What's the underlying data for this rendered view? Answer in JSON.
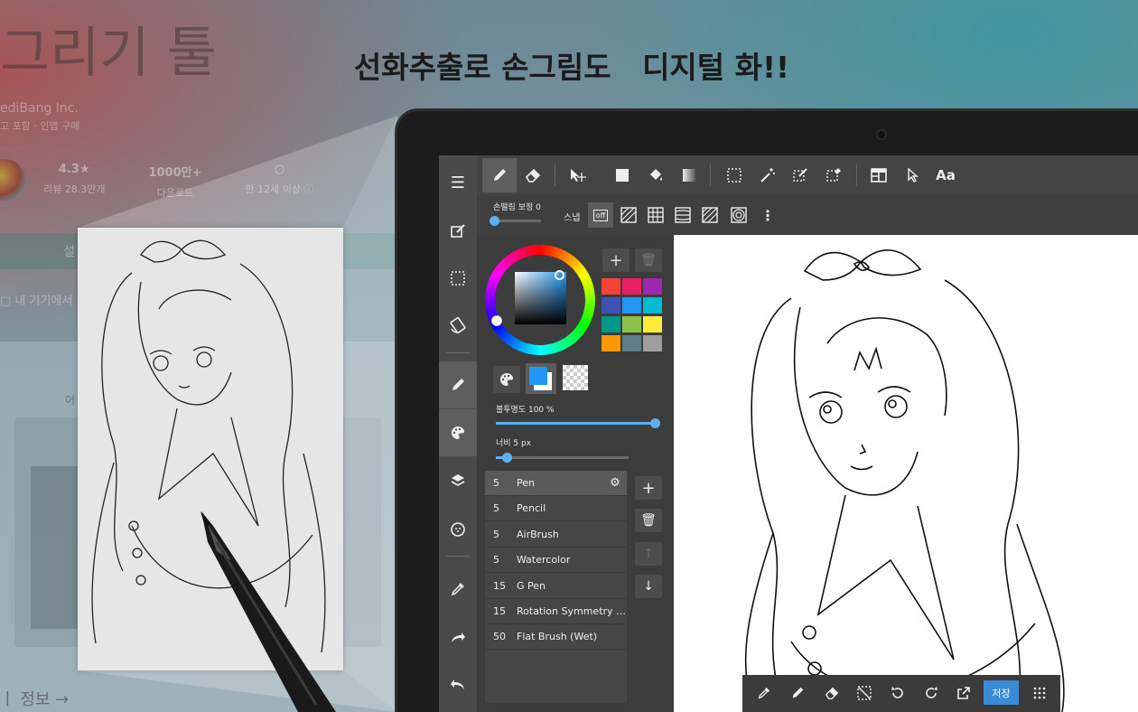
{
  "background": {
    "store_title": "그리기 툴",
    "developer": "ediBang Inc.",
    "ads_line": "고 포함 · 인앱 구매",
    "rating": "4.3★",
    "rating_label": "리뷰 28.3만개",
    "downloads": "1000만+",
    "downloads_label": "다운로드",
    "age_label": "만 12세 이상 ⓘ",
    "install_label": "설",
    "my_device": "내 기기에서",
    "section_prefix": "어",
    "info_label": "정보  →"
  },
  "headline": "선화추출로 손그림도   디지털 화!!",
  "toolbar": {
    "tools": [
      "pen-icon",
      "eraser-icon",
      "move-icon",
      "fill-rect-icon",
      "bucket-icon",
      "gradient-icon",
      "select-rect-icon",
      "magic-wand-icon",
      "select-pen-icon",
      "select-eraser-icon",
      "panel-layout-icon",
      "pointer-icon"
    ],
    "text_tool": "Aa"
  },
  "subbar": {
    "stabilizer_label": "손떨림 보정",
    "stabilizer_value": "0",
    "snap_label": "스냅",
    "snap_off": "off"
  },
  "color_panel": {
    "swatches": [
      "#f44336",
      "#e91e63",
      "#9c27b0",
      "#3f51b5",
      "#2196f3",
      "#00bcd4",
      "#009688",
      "#8bc34a",
      "#ffeb3b",
      "#ff9800",
      "#607d8b",
      "#9e9e9e"
    ],
    "foreground": "#2196f3",
    "opacity_label": "불투명도 100 %",
    "opacity": 1.0,
    "width_label": "너비 5 px",
    "width_fraction": 0.08
  },
  "brushes": [
    {
      "size": "5",
      "name": "Pen",
      "selected": true
    },
    {
      "size": "5",
      "name": "Pencil",
      "selected": false
    },
    {
      "size": "5",
      "name": "AirBrush",
      "selected": false
    },
    {
      "size": "5",
      "name": "Watercolor",
      "selected": false
    },
    {
      "size": "15",
      "name": "G Pen",
      "selected": false
    },
    {
      "size": "15",
      "name": "Rotation Symmetry Ed...",
      "selected": false
    },
    {
      "size": "50",
      "name": "Flat Brush (Wet)",
      "selected": false
    }
  ],
  "bottom_bar": {
    "save_label": "저장"
  },
  "accent": "#3a8ad8"
}
